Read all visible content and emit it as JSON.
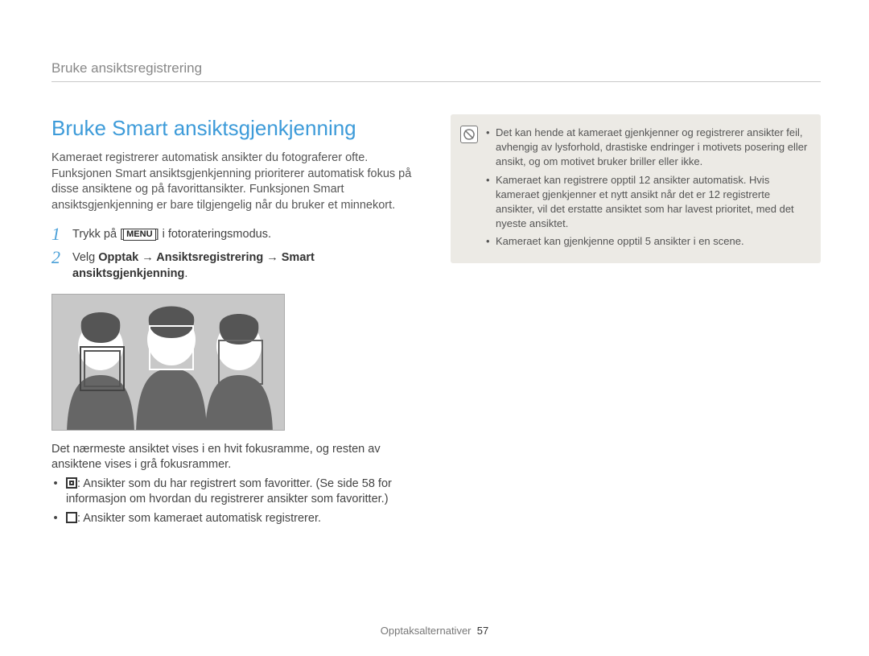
{
  "header": {
    "section": "Bruke ansiktsregistrering"
  },
  "main": {
    "title": "Bruke Smart ansiktsgjenkjenning",
    "intro": "Kameraet registrerer automatisk ansikter du fotograferer ofte. Funksjonen Smart ansiktsgjenkjenning prioriterer automatisk fokus på disse ansiktene og på favorittansikter. Funksjonen Smart ansiktsgjenkjenning er bare tilgjengelig når du bruker et minnekort.",
    "steps": {
      "one": {
        "pre": "Trykk på [",
        "menu": "MENU",
        "post": "] i fotorateringsmodus."
      },
      "two": {
        "pre": "Velg ",
        "bold1": "Opptak",
        "arrow": " → ",
        "bold2": "Ansiktsregistrering",
        "bold3": "Smart ansiktsgjenkjenning",
        "period": "."
      }
    },
    "after_image": "Det nærmeste ansiktet vises i en hvit fokusramme, og resten av ansiktene vises i grå fokusrammer.",
    "bullets": {
      "fav": ": Ansikter som du har registrert som favoritter. (Se side 58 for informasjon om hvordan du registrerer ansikter som favoritter.)",
      "auto": ": Ansikter som kameraet automatisk registrerer."
    }
  },
  "notes": {
    "items": [
      "Det kan hende at kameraet gjenkjenner og registrerer ansikter feil, avhengig av lysforhold, drastiske endringer i motivets posering eller ansikt, og om motivet bruker briller eller ikke.",
      "Kameraet kan registrere opptil 12 ansikter automatisk. Hvis kameraet gjenkjenner et nytt ansikt når det er 12 registrerte ansikter, vil det erstatte ansiktet som har lavest prioritet, med det nyeste ansiktet.",
      "Kameraet kan gjenkjenne opptil 5 ansikter i en scene."
    ]
  },
  "footer": {
    "label": "Opptaksalternativer",
    "page": "57"
  }
}
